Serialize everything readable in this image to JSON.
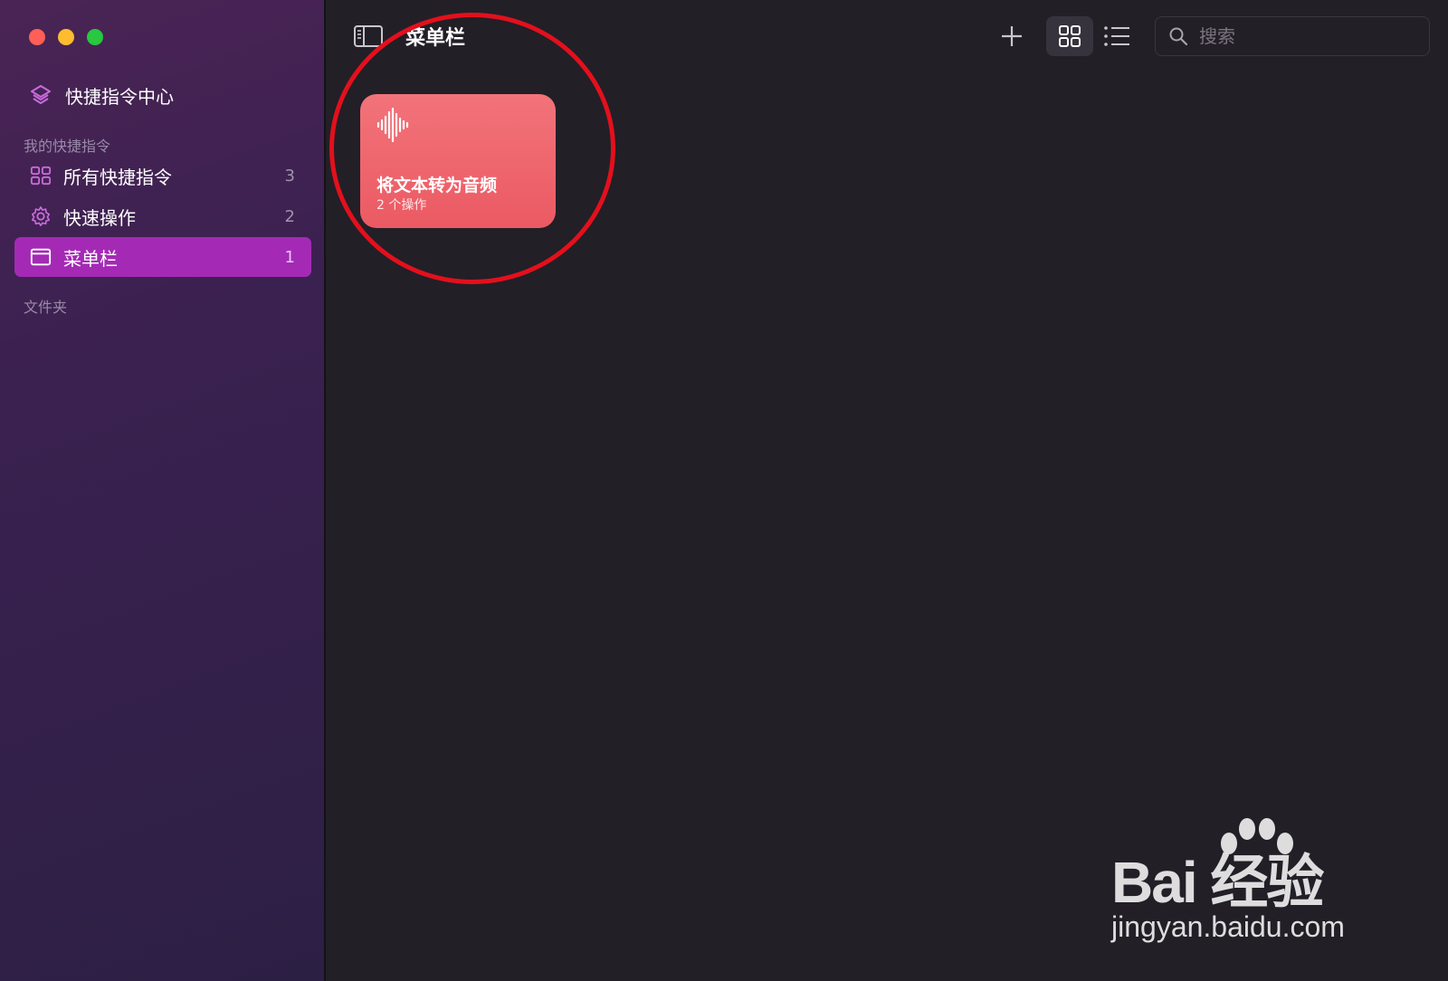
{
  "sidebar": {
    "gallery_label": "快捷指令中心",
    "my_shortcuts_section": "我的快捷指令",
    "items": [
      {
        "label": "所有快捷指令",
        "count": "3",
        "icon": "grid-icon"
      },
      {
        "label": "快速操作",
        "count": "2",
        "icon": "gear-icon"
      },
      {
        "label": "菜单栏",
        "count": "1",
        "icon": "menubar-icon",
        "selected": true
      }
    ],
    "folders_section": "文件夹"
  },
  "toolbar": {
    "title": "菜单栏",
    "search_placeholder": "搜索"
  },
  "shortcuts": [
    {
      "title": "将文本转为音频",
      "subtitle": "2 个操作",
      "color": "#ee6069",
      "icon": "waveform-icon"
    }
  ],
  "watermark": {
    "logo": "Bai  经验",
    "url": "jingyan.baidu.com"
  },
  "colors": {
    "accent_selected": "#a42ab5",
    "annotation": "#e3101c",
    "card": "#ee6069"
  }
}
